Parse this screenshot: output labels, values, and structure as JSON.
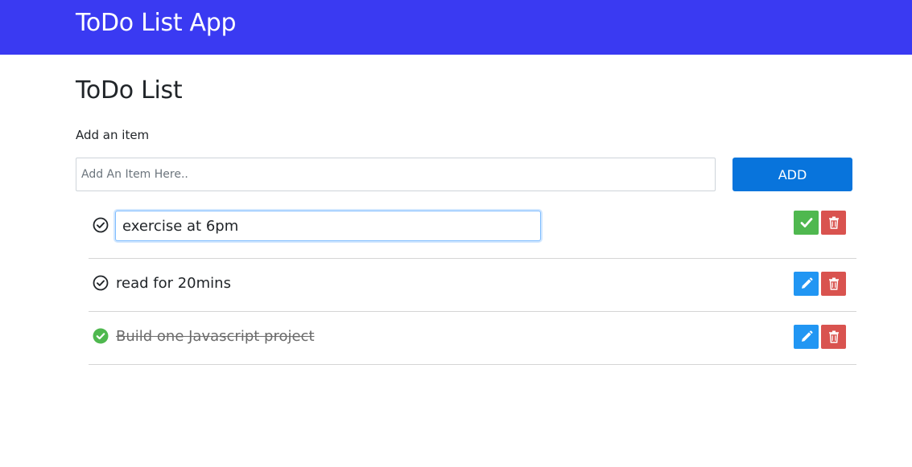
{
  "navbar": {
    "brand": "ToDo List App",
    "color": "#3a3af2"
  },
  "main": {
    "title": "ToDo List",
    "add_label": "Add an item",
    "add_input": {
      "placeholder": "Add An Item Here..",
      "value": ""
    },
    "add_button_label": "ADD"
  },
  "todos": [
    {
      "text": "exercise at 6pm",
      "completed": false,
      "editing": true,
      "icons": [
        "check-circle-outline-icon",
        "check-icon",
        "trash-icon"
      ]
    },
    {
      "text": "read for 20mins",
      "completed": false,
      "editing": false,
      "icons": [
        "check-circle-outline-icon",
        "pencil-icon",
        "trash-icon"
      ]
    },
    {
      "text": "Build one Javascript project",
      "completed": true,
      "editing": false,
      "icons": [
        "check-circle-filled-icon",
        "pencil-icon",
        "trash-icon"
      ]
    }
  ],
  "colors": {
    "add_button": "#0874dc",
    "save_button": "#4fb84f",
    "edit_button": "#2196f3",
    "delete_button": "#d9534f",
    "completed_check": "#4fb84f"
  }
}
